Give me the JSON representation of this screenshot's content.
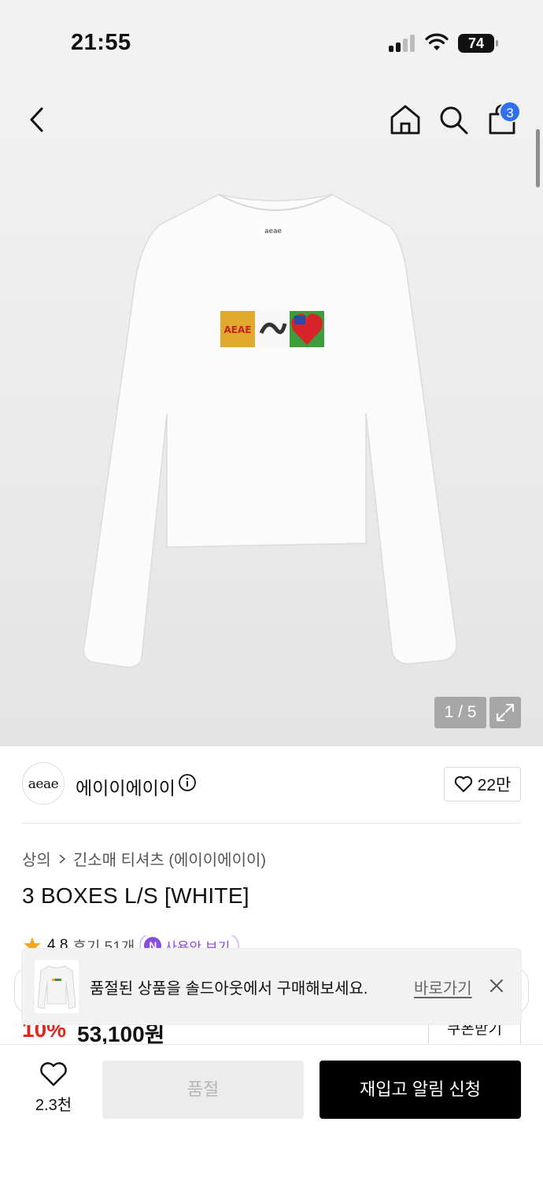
{
  "status_bar": {
    "time": "21:55",
    "battery": "74"
  },
  "header": {
    "cart_count": "3"
  },
  "gallery": {
    "counter": "1 / 5"
  },
  "brand": {
    "logo_text": "aeae",
    "name": "에이이에이이",
    "likes": "22만"
  },
  "breadcrumb": {
    "category": "상의",
    "subcategory": "긴소매 티셔츠 (에이이에이이)"
  },
  "product": {
    "title": "3 BOXES L/S [WHITE]",
    "rating": "4.8",
    "reviews": "후기 51개",
    "badge": "사용안 보기",
    "discount": "10%",
    "price": "53,100원",
    "coupon": "쿠폰받기"
  },
  "toast": {
    "message": "품절된 상품을 솔드아웃에서 구매해보세요.",
    "link": "바로가기"
  },
  "bottom_bar": {
    "wish_count": "2.3천",
    "soldout": "품절",
    "restock": "재입고 알림 신청"
  },
  "colors": {
    "accent": "#2f6ff0",
    "discount": "#e0261f",
    "primary_button": "#000000"
  }
}
